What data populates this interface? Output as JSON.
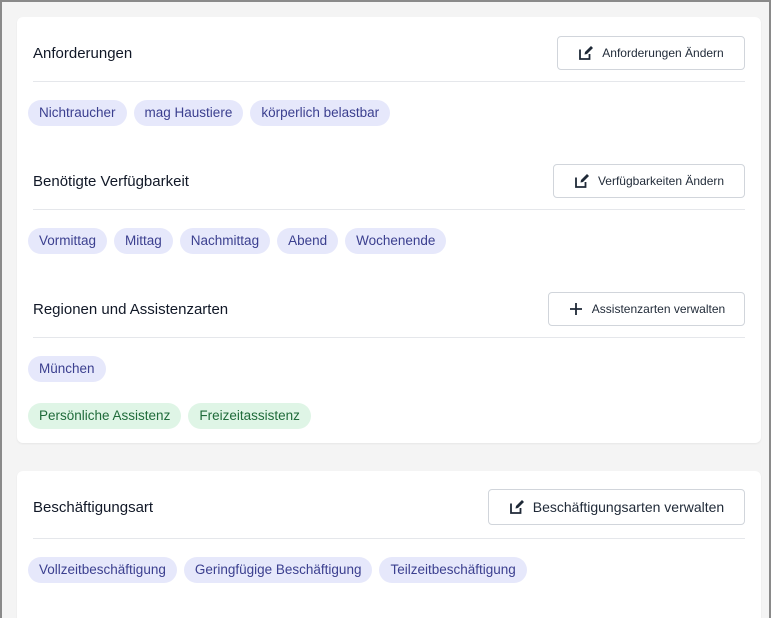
{
  "sections": {
    "anforderungen": {
      "title": "Anforderungen",
      "button_label": "Anforderungen Ändern",
      "tags": [
        "Nichtraucher",
        "mag Haustiere",
        "körperlich belastbar"
      ]
    },
    "verfuegbarkeit": {
      "title": "Benötigte Verfügbarkeit",
      "button_label": "Verfügbarkeiten Ändern",
      "tags": [
        "Vormittag",
        "Mittag",
        "Nachmittag",
        "Abend",
        "Wochenende"
      ]
    },
    "regionen": {
      "title": "Regionen und Assistenzarten",
      "button_label": "Assistenzarten verwalten",
      "region_tags": [
        "München"
      ],
      "assistance_tags": [
        "Persönliche Assistenz",
        "Freizeitassistenz"
      ]
    },
    "beschaeftigung": {
      "title": "Beschäftigungsart",
      "button_label": "Beschäftigungsarten verwalten",
      "tags": [
        "Vollzeitbeschäftigung",
        "Geringfügige Beschäftigung",
        "Teilzeitbeschäftigung"
      ]
    }
  },
  "colors": {
    "chip_blue_bg": "#e6e8fb",
    "chip_blue_text": "#3b3f8f",
    "chip_green_bg": "#dff5e6",
    "chip_green_text": "#1f6b3a"
  },
  "icons": {
    "edit": "edit-icon",
    "plus": "plus-icon"
  }
}
